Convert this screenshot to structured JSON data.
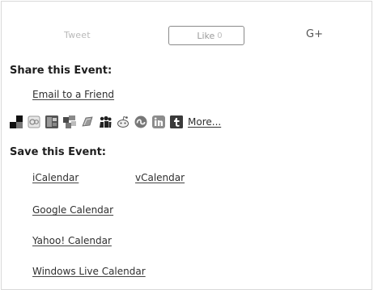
{
  "social": {
    "tweet_label": "Tweet",
    "like_label": "Like",
    "like_count": "0",
    "gplus_label": "G+"
  },
  "share": {
    "title": "Share this Event:",
    "email_link": "Email to a Friend",
    "more_link": "More...",
    "icons": [
      {
        "name": "delicious-icon"
      },
      {
        "name": "digg-icon"
      },
      {
        "name": "facebook-icon"
      },
      {
        "name": "google-bookmarks-icon"
      },
      {
        "name": "live-icon"
      },
      {
        "name": "myspace-icon"
      },
      {
        "name": "reddit-icon"
      },
      {
        "name": "stumbleupon-icon"
      },
      {
        "name": "linkedin-icon"
      },
      {
        "name": "tumblr-icon"
      }
    ]
  },
  "save": {
    "title": "Save this Event:",
    "ical": "iCalendar",
    "vcal": "vCalendar",
    "gcal": "Google Calendar",
    "ycal": "Yahoo! Calendar",
    "wcal": "Windows Live Calendar"
  }
}
